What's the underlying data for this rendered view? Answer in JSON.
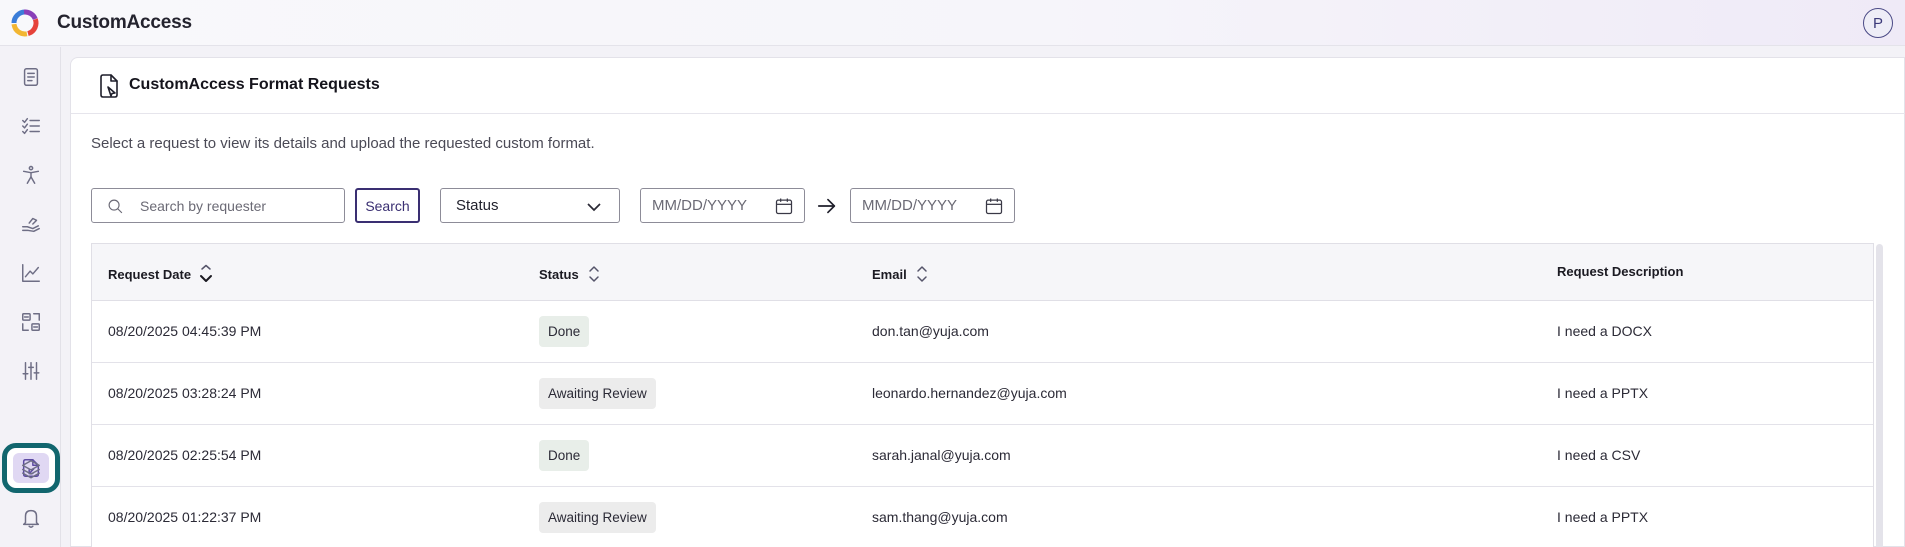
{
  "app": {
    "title": "CustomAccess",
    "avatar_initial": "P"
  },
  "sidebar": {
    "items": [
      {
        "icon": "document-icon"
      },
      {
        "icon": "checklist-icon"
      },
      {
        "icon": "accessibility-icon"
      },
      {
        "icon": "hand-icon"
      },
      {
        "icon": "analytics-icon"
      },
      {
        "icon": "convert-icon"
      },
      {
        "icon": "sliders-icon"
      },
      {
        "icon": "format-request-icon",
        "active": true
      },
      {
        "icon": "layers-icon"
      },
      {
        "icon": "bell-icon"
      }
    ]
  },
  "page": {
    "title": "CustomAccess Format Requests",
    "subtitle": "Select a request to view its details and upload the requested custom format."
  },
  "filters": {
    "search_placeholder": "Search by requester",
    "search_button": "Search",
    "status_label": "Status",
    "date_from_placeholder": "MM/DD/YYYY",
    "date_to_placeholder": "MM/DD/YYYY"
  },
  "table": {
    "columns": [
      "Request Date",
      "Status",
      "Email",
      "Request Description"
    ],
    "rows": [
      {
        "date": "08/20/2025 04:45:39 PM",
        "status": "Done",
        "email": "don.tan@yuja.com",
        "description": "I need a DOCX"
      },
      {
        "date": "08/20/2025 03:28:24 PM",
        "status": "Awaiting Review",
        "email": "leonardo.hernandez@yuja.com",
        "description": "I need a PPTX"
      },
      {
        "date": "08/20/2025 02:25:54 PM",
        "status": "Done",
        "email": "sarah.janal@yuja.com",
        "description": "I need a CSV"
      },
      {
        "date": "08/20/2025 01:22:37 PM",
        "status": "Awaiting Review",
        "email": "sam.thang@yuja.com",
        "description": "I need a PPTX"
      }
    ]
  },
  "colors": {
    "accent": "#3a2f72",
    "active_border": "#11666e",
    "active_bg": "#e0d8f3"
  }
}
